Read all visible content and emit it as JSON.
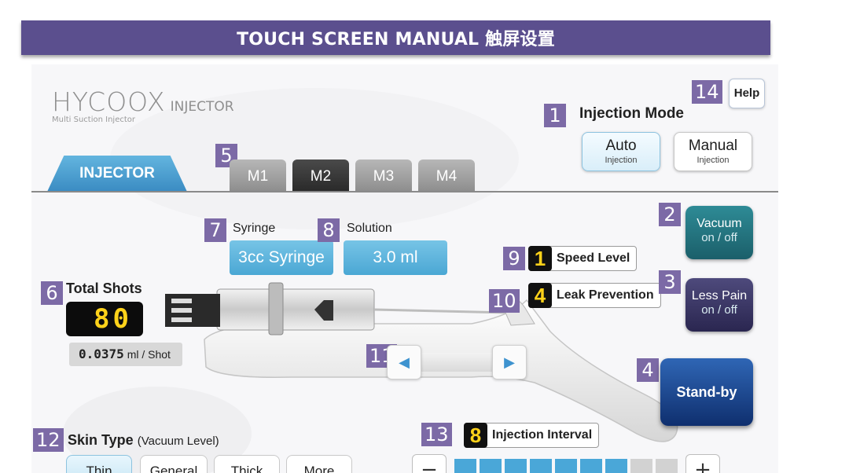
{
  "banner": {
    "title": "TOUCH SCREEN MANUAL 触屏设置"
  },
  "logo": {
    "name": "HYCOOX",
    "product": "INJECTOR",
    "subtitle": "Multi Suction Injector"
  },
  "markers": [
    "1",
    "2",
    "3",
    "4",
    "5",
    "6",
    "7",
    "8",
    "9",
    "10",
    "11",
    "12",
    "13",
    "14"
  ],
  "help": {
    "label": "Help"
  },
  "injection_mode": {
    "title": "Injection Mode",
    "auto": {
      "label": "Auto",
      "sub": "Injection"
    },
    "manual": {
      "label": "Manual",
      "sub": "Injection"
    }
  },
  "tabs": {
    "injector": "INJECTOR",
    "memory": [
      "M1",
      "M2",
      "M3",
      "M4"
    ],
    "active": "M2"
  },
  "syringe": {
    "label": "Syringe",
    "value": "3cc Syringe"
  },
  "solution": {
    "label": "Solution",
    "value": "3.0 ml"
  },
  "speed": {
    "value": "1",
    "label": "Speed Level"
  },
  "leak": {
    "value": "4",
    "label": "Leak Prevention"
  },
  "vacuum": {
    "label": "Vacuum",
    "state": "on / off"
  },
  "less_pain": {
    "label": "Less Pain",
    "state": "on / off"
  },
  "standby": {
    "label": "Stand-by"
  },
  "total_shots": {
    "label": "Total Shots",
    "value": "80"
  },
  "ml_per_shot": {
    "value": "0.0375",
    "unit": "ml / Shot"
  },
  "nav": {
    "left_icon": "left-triangle-icon",
    "right_icon": "right-triangle-icon"
  },
  "skin": {
    "label": "Skin Type",
    "sub": "(Vacuum Level)",
    "options": [
      "Thin",
      "General",
      "Thick",
      "More"
    ],
    "active": "Thin"
  },
  "interval": {
    "value": "8",
    "label": "Injection Interval",
    "minus": "−",
    "plus": "+",
    "filled_segments": 7
  },
  "colors": {
    "banner": "#5b4f8e",
    "marker": "#7c6aa6",
    "accent_blue": "#4aa7d4",
    "digit_yellow": "#ffd21a"
  }
}
